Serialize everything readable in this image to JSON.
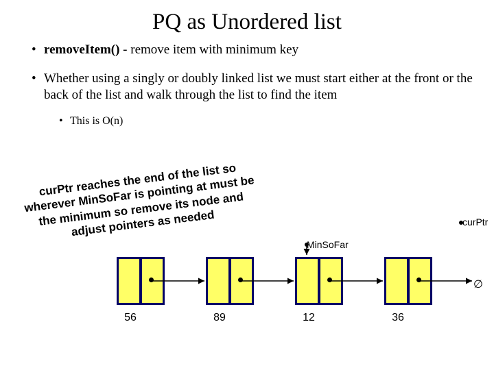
{
  "title": "PQ as Unordered list",
  "bullet1_strong": "removeItem()",
  "bullet1_rest": " - remove item with minimum key",
  "bullet2": "Whether using a singly or doubly linked list we must start either at the front or the back of the list and walk through the list to find the item",
  "bullet2_sub": "This is O(n)",
  "callout": "curPtr reaches the end of the list so wherever MinSoFar is pointing at must be the minimum so remove its node and adjust pointers as needed",
  "label_minsofar": "MinSoFar",
  "label_curptr": "curPtr",
  "empty": "∅",
  "nodes": [
    "56",
    "89",
    "12",
    "36"
  ],
  "chart_data": {
    "type": "diagram",
    "structure": "singly-linked-list",
    "values": [
      56,
      89,
      12,
      36
    ],
    "pointers": {
      "MinSoFar": 2,
      "curPtr": "end"
    },
    "terminator": "null"
  }
}
